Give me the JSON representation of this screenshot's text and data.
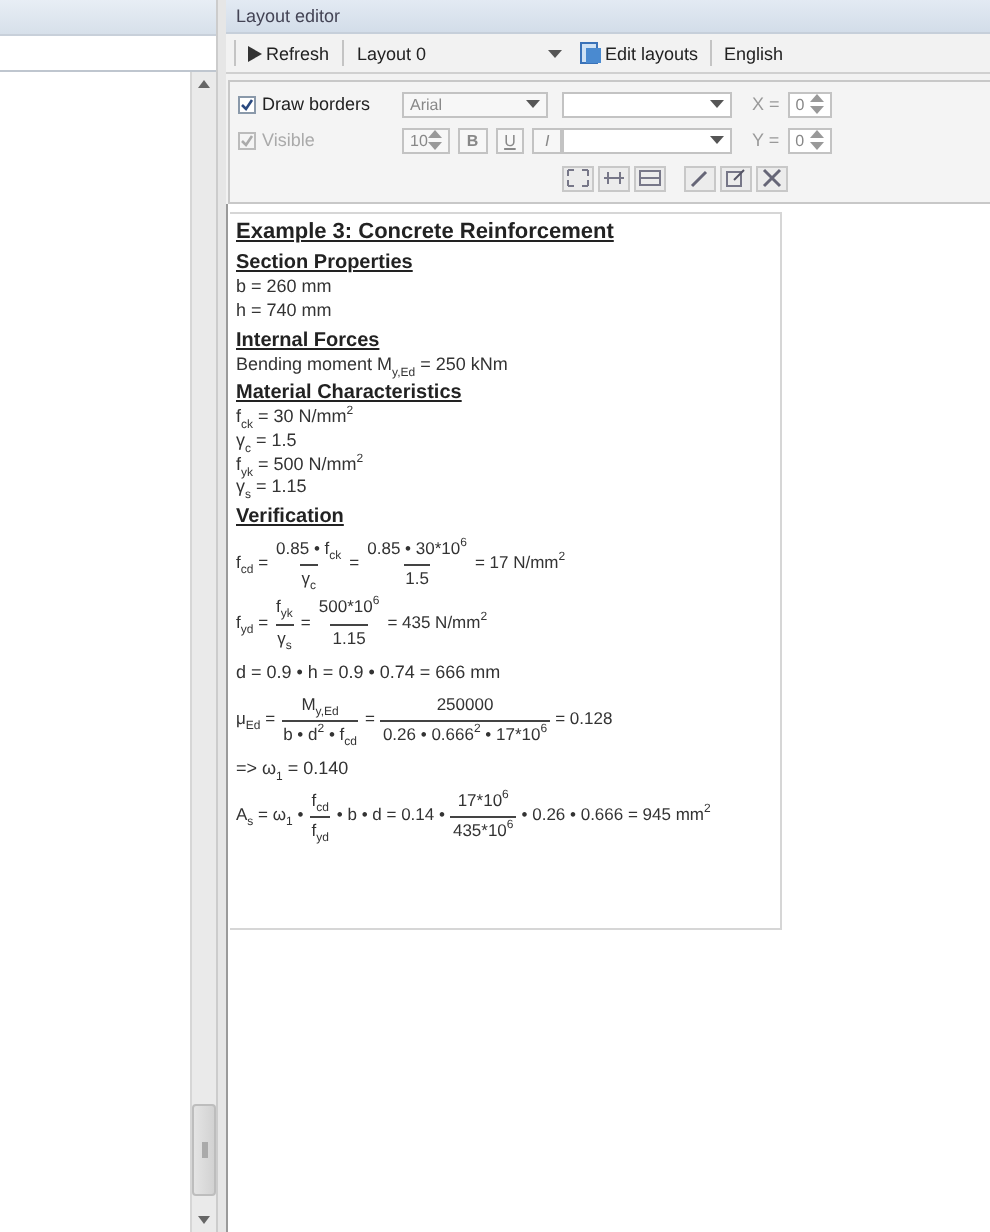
{
  "layout_editor": {
    "title": "Layout editor",
    "toolbar": {
      "refresh": "Refresh",
      "layout": "Layout 0",
      "edit_layouts": "Edit layouts",
      "language": "English"
    },
    "properties": {
      "checkboxes": [
        {
          "label": "Draw borders",
          "checked": true,
          "disabled": false
        },
        {
          "label": "Visible",
          "checked": true,
          "disabled": true
        }
      ],
      "font": "Arial",
      "size": "10",
      "style_buttons": [
        {
          "label": "B",
          "kind": "bold"
        },
        {
          "label": "U",
          "kind": "underline"
        },
        {
          "label": "I",
          "kind": "italic"
        }
      ],
      "x_label": "X =",
      "x_value": "0",
      "y_label": "Y =",
      "y_value": "0"
    }
  },
  "document": {
    "title": "Example 3: Concrete Reinforcement",
    "lines": [
      {
        "kind": "heading",
        "text": "Section Properties"
      },
      {
        "kind": "text",
        "text": "b = 260 mm"
      },
      {
        "kind": "text",
        "text": "h = 740 mm"
      },
      {
        "kind": "heading",
        "text": "Internal Forces"
      },
      {
        "kind": "text",
        "text": "Bending moment M$_{y,Ed}$ = 250 kNm"
      },
      {
        "kind": "heading",
        "text": "Material Characteristics"
      },
      {
        "kind": "text",
        "text": "f$_{ck}$ = 30 N/mm$^{2}$"
      },
      {
        "kind": "text",
        "text": "γ$_{c}$ = 1.5"
      },
      {
        "kind": "text",
        "text": "f$_{yk}$ = 500 N/mm$^{2}$"
      },
      {
        "kind": "text",
        "text": "γ$_{s}$ = 1.15"
      },
      {
        "kind": "heading",
        "text": "Verification"
      },
      {
        "kind": "formula",
        "parts": [
          {
            "kind": "text",
            "text": "f$_{cd}$ ="
          },
          {
            "kind": "frac",
            "num": "0.85 • f$_{ck}$",
            "den": "γ$_{c}$"
          },
          {
            "kind": "text",
            "text": "="
          },
          {
            "kind": "frac",
            "num": "0.85 • 30*10$^{6}$",
            "den": "1.5"
          },
          {
            "kind": "text",
            "text": "= 17 N/mm$^{2}$"
          }
        ]
      },
      {
        "kind": "formula",
        "parts": [
          {
            "kind": "text",
            "text": "f$_{yd}$ ="
          },
          {
            "kind": "frac",
            "num": "f$_{yk}$",
            "den": "γ$_{s}$"
          },
          {
            "kind": "text",
            "text": "="
          },
          {
            "kind": "frac",
            "num": "500*10$^{6}$",
            "den": "1.15"
          },
          {
            "kind": "text",
            "text": "= 435 N/mm$^{2}$"
          }
        ]
      },
      {
        "kind": "text",
        "text": "d = 0.9 • h = 0.9 • 0.74 = 666 mm"
      },
      {
        "kind": "formula",
        "parts": [
          {
            "kind": "text",
            "text": "μ$_{Ed}$ ="
          },
          {
            "kind": "frac",
            "num": "M$_{y,Ed}$",
            "den": "b • d$^{2}$ • f$_{cd}$"
          },
          {
            "kind": "text",
            "text": "="
          },
          {
            "kind": "frac",
            "num": "250000",
            "den": "0.26 • 0.666$^{2}$ • 17*10$^{6}$"
          },
          {
            "kind": "text",
            "text": "= 0.128"
          }
        ]
      },
      {
        "kind": "text",
        "text": "=> ω$_{1}$ = 0.140"
      },
      {
        "kind": "formula",
        "parts": [
          {
            "kind": "text",
            "text": "A$_{s}$ = ω$_{1}$ •"
          },
          {
            "kind": "frac",
            "num": "f$_{cd}$",
            "den": "f$_{yd}$"
          },
          {
            "kind": "text",
            "text": "• b • d = 0.14 •"
          },
          {
            "kind": "frac",
            "num": "17*10$^{6}$",
            "den": "435*10$^{6}$"
          },
          {
            "kind": "text",
            "text": "• 0.26 • 0.666 = 945 mm$^{2}$"
          }
        ]
      }
    ]
  }
}
